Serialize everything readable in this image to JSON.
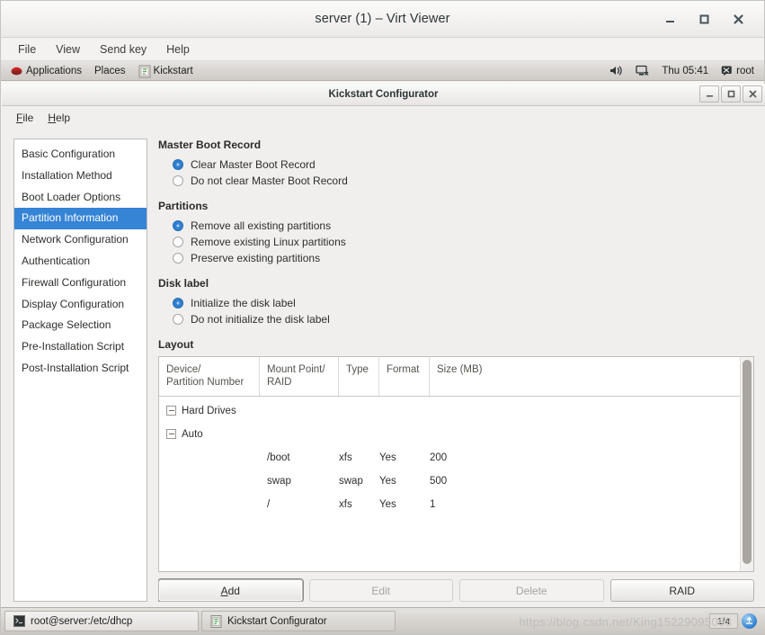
{
  "outer_window": {
    "title": "server (1) – Virt Viewer",
    "buttons": {
      "minimize": "minimize-icon",
      "maximize": "maximize-icon",
      "close": "close-icon"
    },
    "menus": [
      "File",
      "View",
      "Send key",
      "Help"
    ]
  },
  "gnome_panel": {
    "applications": "Applications",
    "places": "Places",
    "app_title": "Kickstart",
    "volume_icon": "volume-icon",
    "network_icon": "network-icon",
    "clock": "Thu 05:41",
    "user": "root",
    "user_icon": "user-icon"
  },
  "ks_window": {
    "title": "Kickstart Configurator",
    "buttons": {
      "minimize": "_",
      "maximize": "□",
      "close": "✕"
    },
    "menus": [
      {
        "mnemonic": "F",
        "rest": "ile"
      },
      {
        "mnemonic": "H",
        "rest": "elp"
      }
    ]
  },
  "sidebar": {
    "items": [
      {
        "label": "Basic Configuration",
        "selected": false
      },
      {
        "label": "Installation Method",
        "selected": false
      },
      {
        "label": "Boot Loader Options",
        "selected": false
      },
      {
        "label": "Partition Information",
        "selected": true
      },
      {
        "label": "Network Configuration",
        "selected": false
      },
      {
        "label": "Authentication",
        "selected": false
      },
      {
        "label": "Firewall Configuration",
        "selected": false
      },
      {
        "label": "Display Configuration",
        "selected": false
      },
      {
        "label": "Package Selection",
        "selected": false
      },
      {
        "label": "Pre-Installation Script",
        "selected": false
      },
      {
        "label": "Post-Installation Script",
        "selected": false
      }
    ]
  },
  "main": {
    "mbr": {
      "title": "Master Boot Record",
      "options": [
        {
          "label": "Clear Master Boot Record",
          "checked": true
        },
        {
          "label": "Do not clear Master Boot Record",
          "checked": false
        }
      ]
    },
    "partitions": {
      "title": "Partitions",
      "options": [
        {
          "label": "Remove all existing partitions",
          "checked": true
        },
        {
          "label": "Remove existing Linux partitions",
          "checked": false
        },
        {
          "label": "Preserve existing partitions",
          "checked": false
        }
      ]
    },
    "disk_label": {
      "title": "Disk label",
      "options": [
        {
          "label": "Initialize the disk label",
          "checked": true
        },
        {
          "label": "Do not initialize the disk label",
          "checked": false
        }
      ]
    },
    "layout": {
      "title": "Layout",
      "columns": [
        "Device/\nPartition Number",
        "Mount Point/\nRAID",
        "Type",
        "Format",
        "Size (MB)"
      ],
      "tree": [
        {
          "kind": "group",
          "label": "Hard Drives",
          "level": 1,
          "expander": "minus-box-icon"
        },
        {
          "kind": "group",
          "label": "Auto",
          "level": 2,
          "expander": "minus-box-icon"
        },
        {
          "kind": "row",
          "device": "",
          "mount": "/boot",
          "type": "xfs",
          "format": "Yes",
          "size": "200"
        },
        {
          "kind": "row",
          "device": "",
          "mount": "swap",
          "type": "swap",
          "format": "Yes",
          "size": "500"
        },
        {
          "kind": "row",
          "device": "",
          "mount": "/",
          "type": "xfs",
          "format": "Yes",
          "size": "1"
        }
      ],
      "scrollbar": "vertical-scrollbar"
    },
    "buttons": [
      {
        "label": "Add",
        "mnemonic": "A",
        "rest": "dd",
        "disabled": false,
        "focused": true
      },
      {
        "label": "Edit",
        "mnemonic": "",
        "rest": "Edit",
        "disabled": true,
        "focused": false
      },
      {
        "label": "Delete",
        "mnemonic": "",
        "rest": "Delete",
        "disabled": true,
        "focused": false
      },
      {
        "label": "RAID",
        "mnemonic": "",
        "rest": "RAID",
        "disabled": false,
        "focused": false
      }
    ]
  },
  "taskbar": {
    "tasks": [
      {
        "label": "root@server:/etc/dhcp",
        "icon": "terminal-icon",
        "active": false
      },
      {
        "label": "Kickstart Configurator",
        "icon": "kickstart-icon",
        "active": true
      }
    ],
    "watermark": "https://blog.csdn.net/King15229095063",
    "workspace": "1/4",
    "workspace_icon": "workspace-switcher-icon"
  },
  "colors": {
    "selection_blue": "#3584d6",
    "radio_blue": "#2f7fd1",
    "panel_gray": "#d9d6d2",
    "window_bg": "#f0efee"
  }
}
